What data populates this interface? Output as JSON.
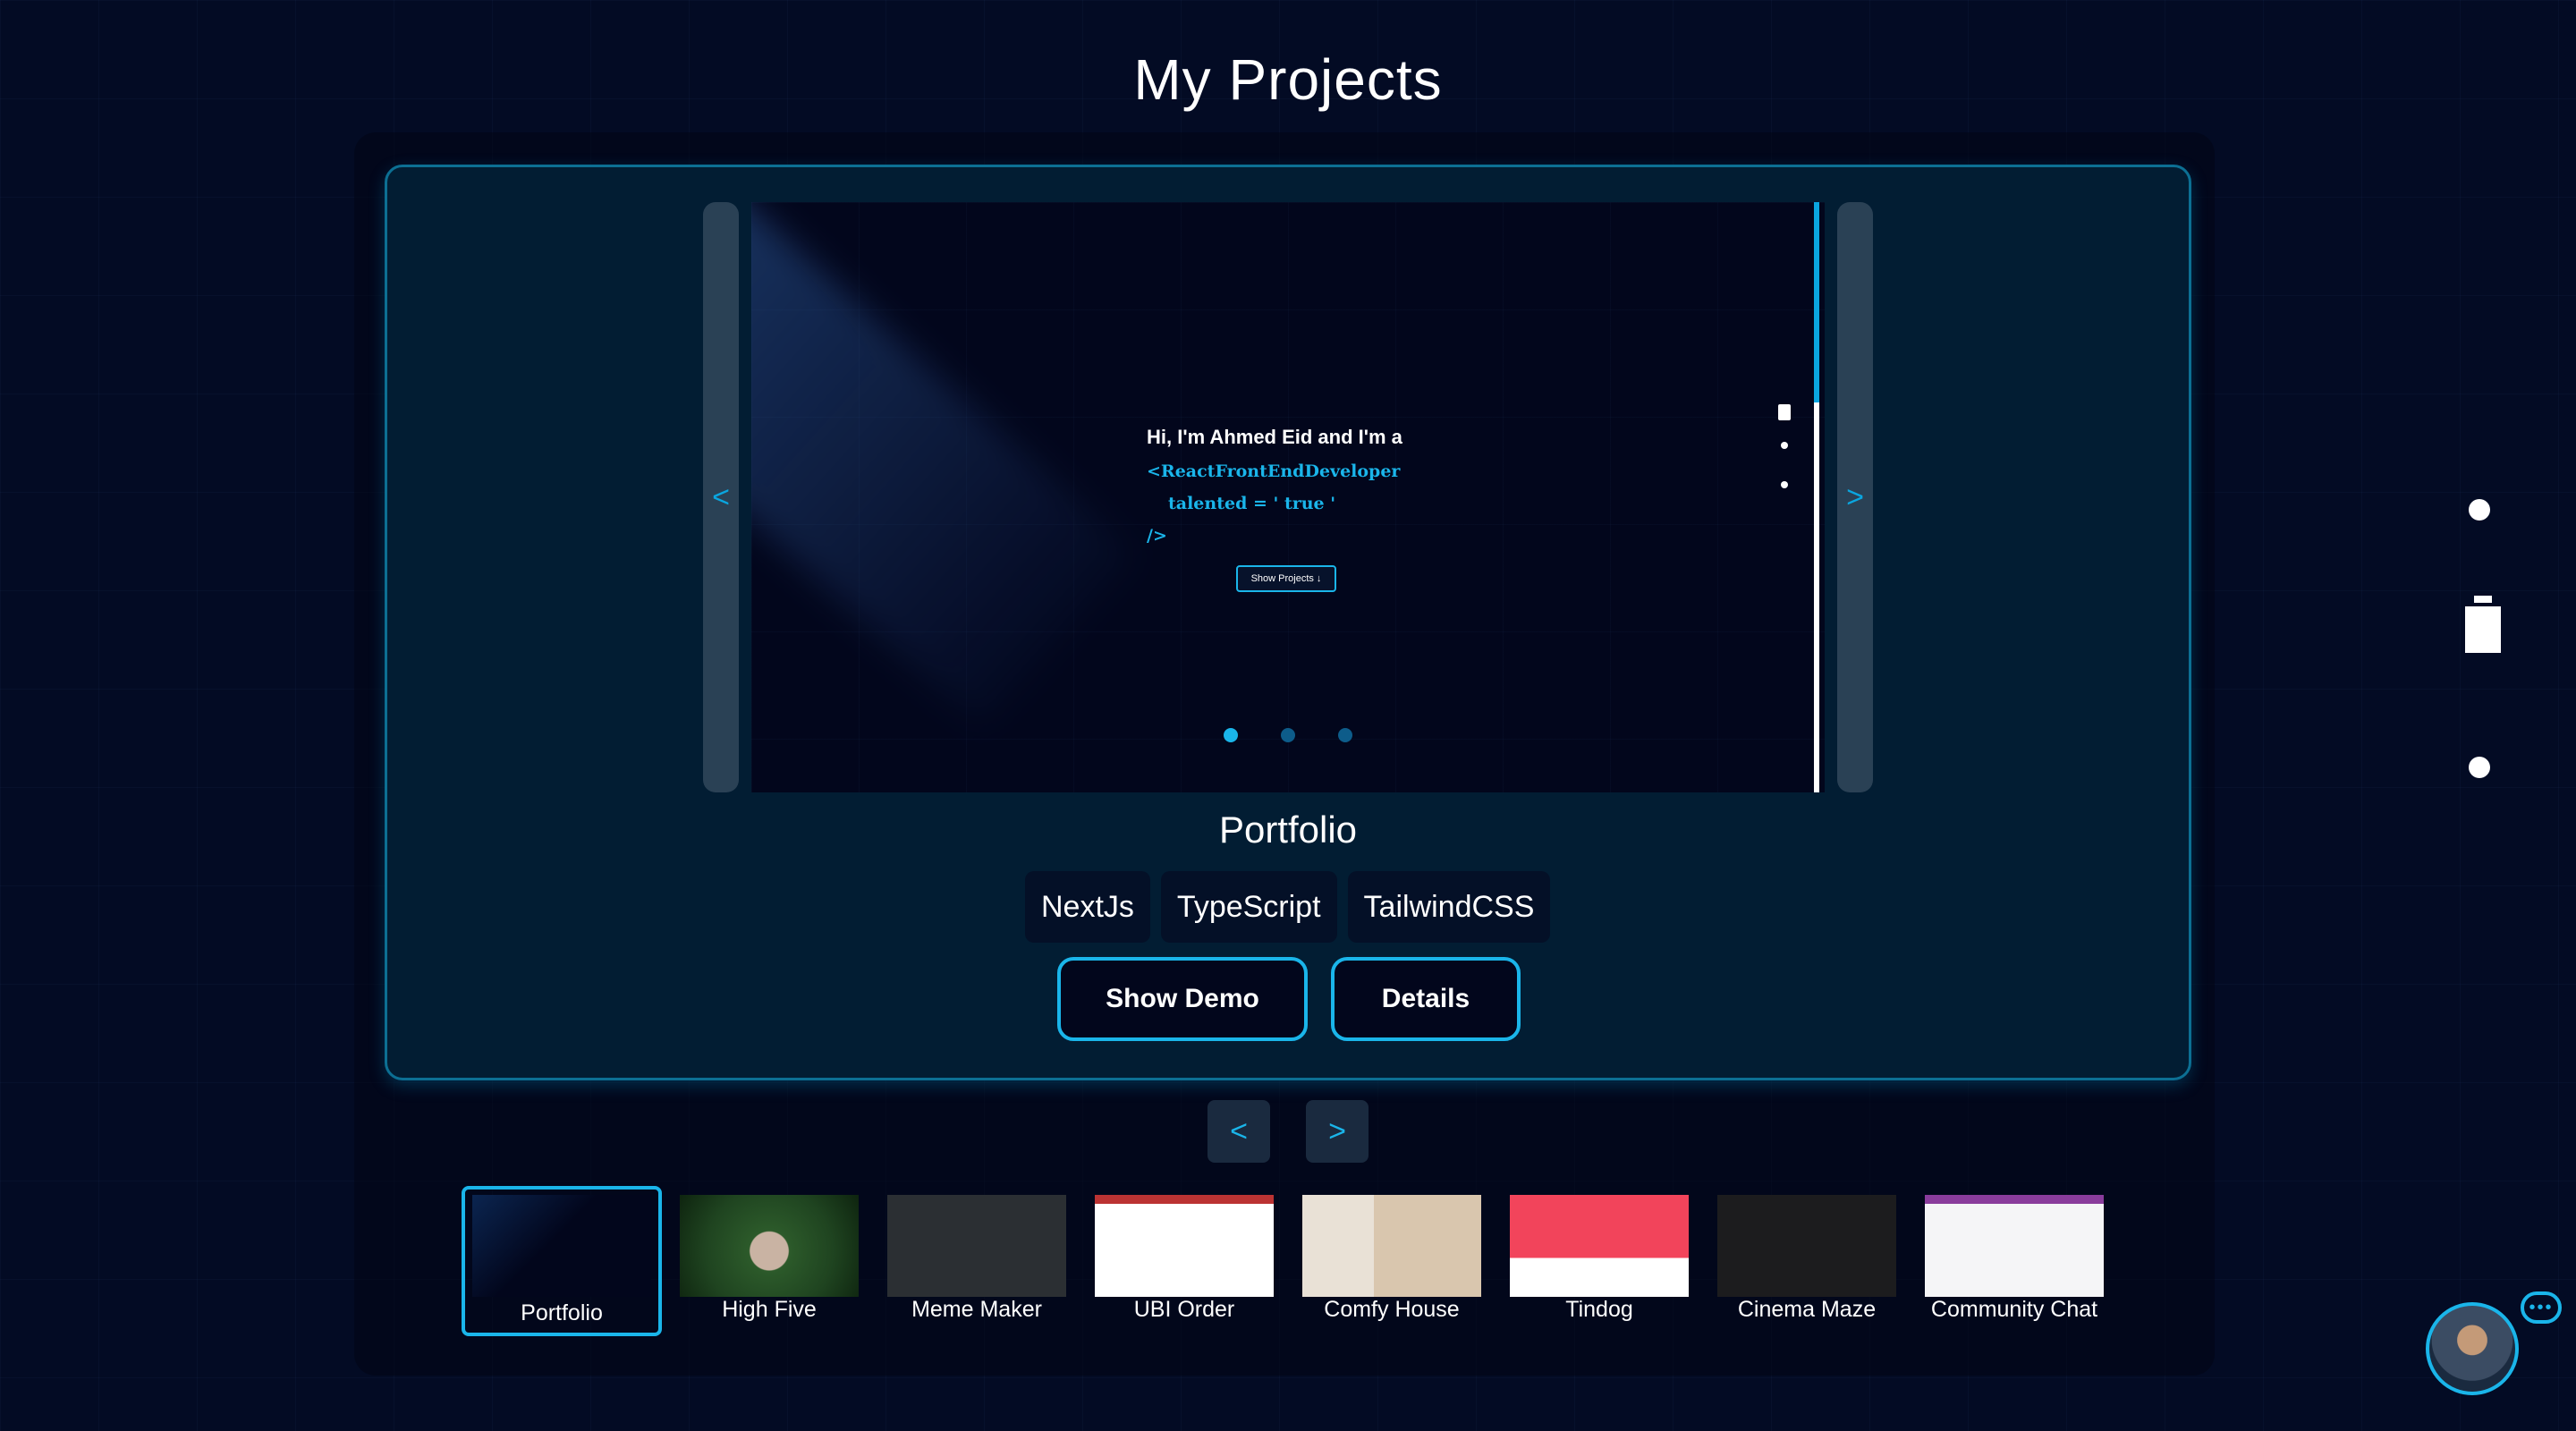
{
  "page": {
    "title": "My Projects"
  },
  "carousel": {
    "prev_label": "<",
    "next_label": ">",
    "preview": {
      "greeting": "Hi, I'm Ahmed Eid and I'm a",
      "code_line_1": "<ReactFrontEndDeveloper",
      "code_line_2": "talented = ' true '",
      "code_line_3": "/>",
      "button_label": "Show Projects ↓",
      "slide_count": 3,
      "active_slide": 1
    }
  },
  "project": {
    "name": "Portfolio",
    "tags": [
      "NextJs",
      "TypeScript",
      "TailwindCSS"
    ],
    "show_demo_label": "Show Demo",
    "details_label": "Details"
  },
  "pager": {
    "prev_label": "<",
    "next_label": ">"
  },
  "thumbnails": [
    {
      "label": "Portfolio",
      "active": true
    },
    {
      "label": "High Five",
      "active": false
    },
    {
      "label": "Meme Maker",
      "active": false
    },
    {
      "label": "UBI Order",
      "active": false
    },
    {
      "label": "Comfy House",
      "active": false
    },
    {
      "label": "Tindog",
      "active": false
    },
    {
      "label": "Cinema Maze",
      "active": false
    },
    {
      "label": "Community Chat",
      "active": false
    }
  ],
  "colors": {
    "accent": "#1ab5ea",
    "background": "#030b24",
    "card": "#021d33"
  },
  "icons": {
    "chat": "chat-bubble-icon",
    "avatar": "avatar",
    "rail": [
      "rail-dot",
      "clipboard-icon",
      "rail-dot"
    ]
  }
}
